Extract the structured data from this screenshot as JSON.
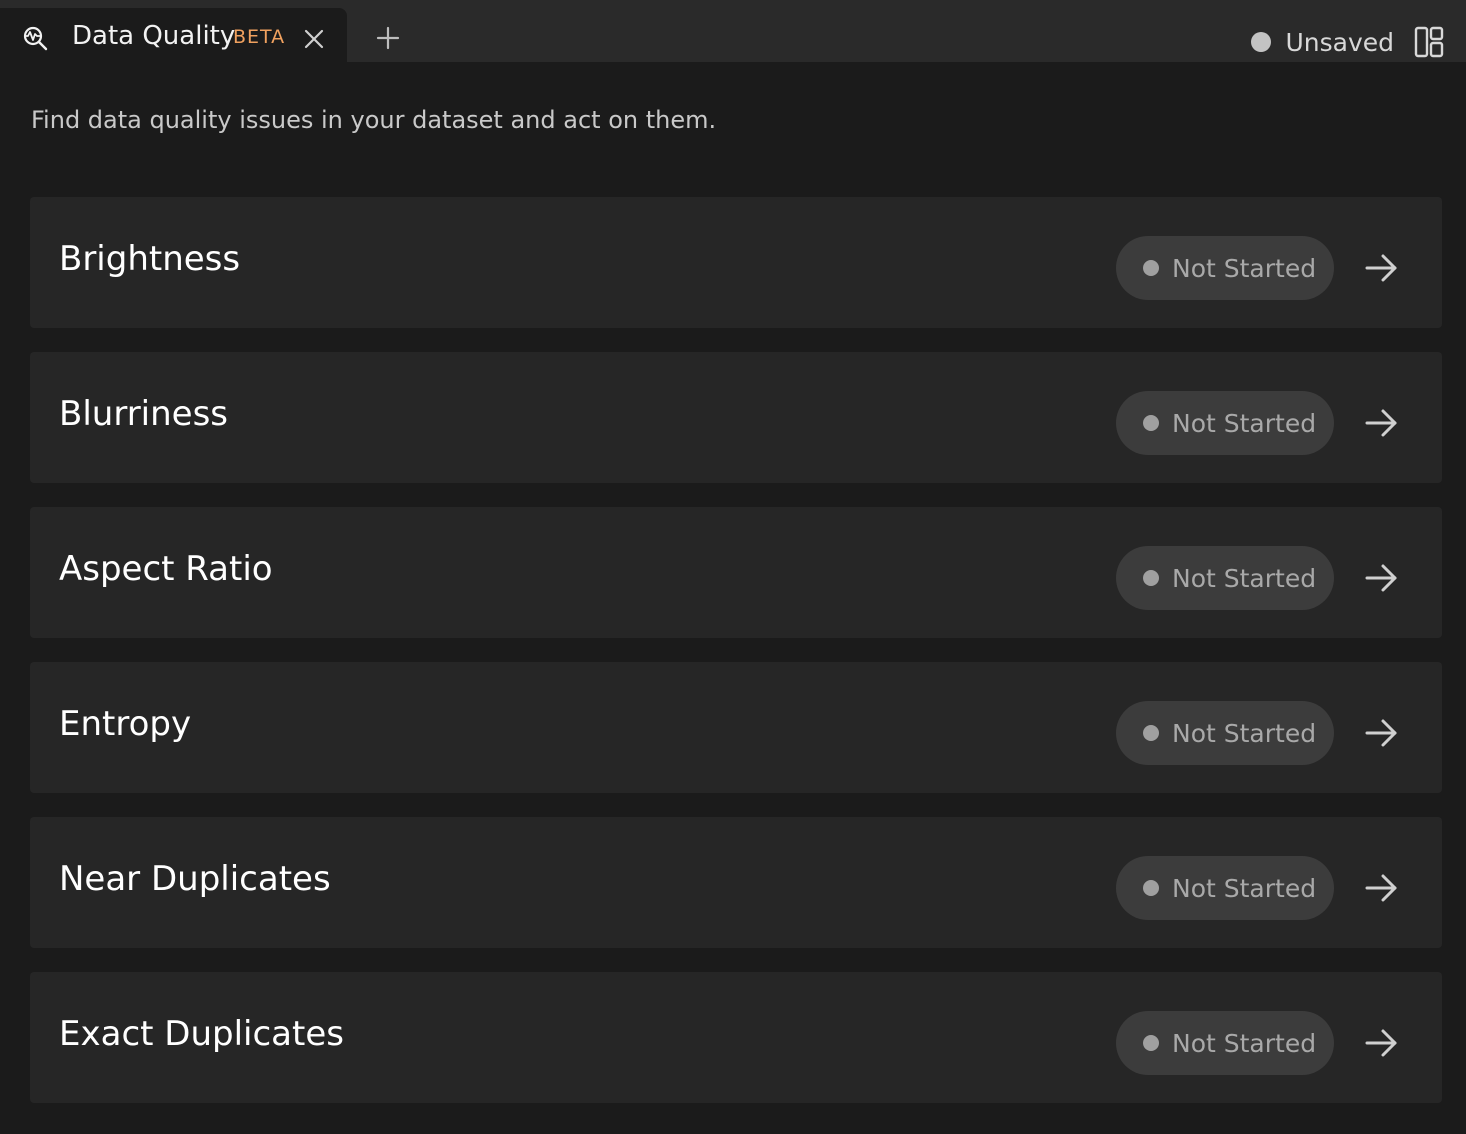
{
  "tab": {
    "title": "Data Quality",
    "badge": "BETA",
    "icon": "data-quality-icon"
  },
  "header": {
    "save_status": "Unsaved"
  },
  "subtitle": "Find data quality issues in your dataset and act on them.",
  "issues": [
    {
      "title": "Brightness",
      "status": "Not Started"
    },
    {
      "title": "Blurriness",
      "status": "Not Started"
    },
    {
      "title": "Aspect Ratio",
      "status": "Not Started"
    },
    {
      "title": "Entropy",
      "status": "Not Started"
    },
    {
      "title": "Near Duplicates",
      "status": "Not Started"
    },
    {
      "title": "Exact Duplicates",
      "status": "Not Started"
    }
  ],
  "colors": {
    "accent_beta": "#f0a15f",
    "background": "#1b1b1b",
    "card": "#262626",
    "pill": "#3c3c3c"
  }
}
